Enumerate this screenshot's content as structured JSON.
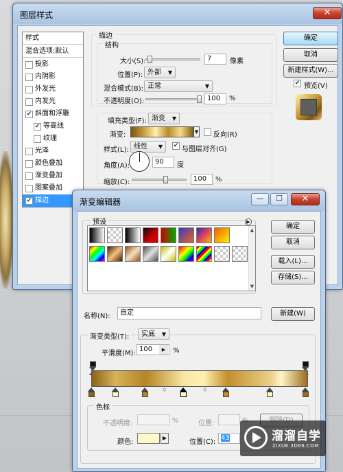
{
  "layer_style_dialog": {
    "title": "图层样式",
    "styles_header": "样式",
    "blend_options": "混合选项:默认",
    "styles": [
      {
        "label": "投影",
        "checked": false
      },
      {
        "label": "内阴影",
        "checked": false
      },
      {
        "label": "外发光",
        "checked": false
      },
      {
        "label": "内发光",
        "checked": false
      },
      {
        "label": "斜面和浮雕",
        "checked": true
      },
      {
        "label": "等高线",
        "checked": true
      },
      {
        "label": "纹理",
        "checked": false
      },
      {
        "label": "光泽",
        "checked": false
      },
      {
        "label": "颜色叠加",
        "checked": false
      },
      {
        "label": "渐变叠加",
        "checked": false
      },
      {
        "label": "图案叠加",
        "checked": false
      },
      {
        "label": "描边",
        "checked": true
      }
    ],
    "section_title": "描边",
    "structure_title": "结构",
    "size_label": "大小(S):",
    "size_value": "7",
    "size_unit": "像素",
    "position_label": "位置(P):",
    "position_value": "外部",
    "blend_mode_label": "混合模式(B):",
    "blend_mode_value": "正常",
    "opacity_label": "不透明度(O):",
    "opacity_value": "100",
    "percent": "%",
    "fill_type_label": "填充类型(F):",
    "fill_type_value": "渐变",
    "gradient_label": "渐变:",
    "reverse_label": "反向(R)",
    "style_label": "样式(L):",
    "style_value": "线性",
    "align_label": "与图层对齐(G)",
    "angle_label": "角度(A):",
    "angle_value": "90",
    "angle_unit": "度",
    "scale_label": "缩放(C):",
    "scale_value": "100",
    "ok": "确定",
    "cancel": "取消",
    "new_style": "新建样式(W)...",
    "preview": "预览(V)",
    "close_glyph": "✕"
  },
  "gradient_editor": {
    "title": "渐变编辑器",
    "presets_label": "预设",
    "ok": "确定",
    "cancel": "取消",
    "load": "载入(L)...",
    "save": "存储(S)...",
    "name_label": "名称(N):",
    "name_value": "自定",
    "new_button": "新建(W)",
    "gradient_type_label": "渐变类型(T):",
    "gradient_type_value": "实底",
    "smoothness_label": "平滑度(M):",
    "smoothness_value": "100",
    "percent": "%",
    "stops_title": "色标",
    "opacity_label": "不透明度:",
    "location_label": "位置:",
    "delete": "删除(D)",
    "color_label": "颜色:",
    "location_c_label": "位置(C):",
    "location_c_value": "43",
    "minimize_glyph": "—",
    "maximize_glyph": "☐",
    "close_glyph": "✕"
  },
  "watermark": {
    "main": "溜溜自学",
    "sub": "ZIXUE.3D66.COM"
  },
  "colors": {
    "gold_dark": "#8a6414",
    "gold_light": "#fff1b0",
    "selected_blue": "#3399ff",
    "current_stop_color": "#fff9c7"
  }
}
